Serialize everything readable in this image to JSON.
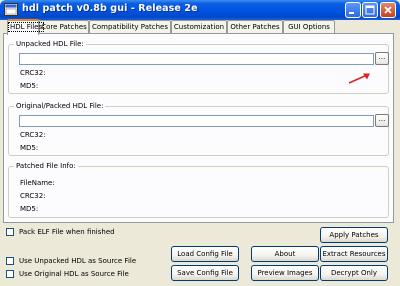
{
  "window": {
    "title": "hdl patch v0.8b gui - Release 2e"
  },
  "tabs": [
    {
      "label": "HDL Files",
      "active": true
    },
    {
      "label": "Core Patches"
    },
    {
      "label": "Compatibility Patches"
    },
    {
      "label": "Customization"
    },
    {
      "label": "Other Patches"
    },
    {
      "label": "GUI Options"
    }
  ],
  "unpacked": {
    "title": "Unpacked HDL File:",
    "value": "",
    "browse": "...",
    "crc_label": "CRC32:",
    "md5_label": "MD5:"
  },
  "packed": {
    "title": "Original/Packed HDL File:",
    "value": "",
    "browse": "...",
    "crc_label": "CRC32:",
    "md5_label": "MD5:"
  },
  "patched": {
    "title": "Patched File Info:",
    "filename_label": "FileName:",
    "crc_label": "CRC32:",
    "md5_label": "MD5:"
  },
  "options": {
    "pack_elf": "Pack ELF File when finished",
    "use_unpacked": "Use Unpacked HDL as Source File",
    "use_original": "Use Original HDL as Source File"
  },
  "buttons": {
    "load_config": "Load Config File",
    "about": "About",
    "extract": "Extract Resources",
    "apply": "Apply Patches",
    "save_config": "Save Config File",
    "preview": "Preview Images",
    "decrypt": "Decrypt Only"
  },
  "colors": {
    "titlebar": "#0054e3",
    "active_tab_accent": "#e68b2c",
    "annotation_arrow": "#e02020"
  },
  "icons": {
    "app": "app-icon",
    "minimize": "minimize-icon",
    "maximize": "maximize-icon",
    "close": "close-icon",
    "annotation": "red-arrow-icon"
  }
}
